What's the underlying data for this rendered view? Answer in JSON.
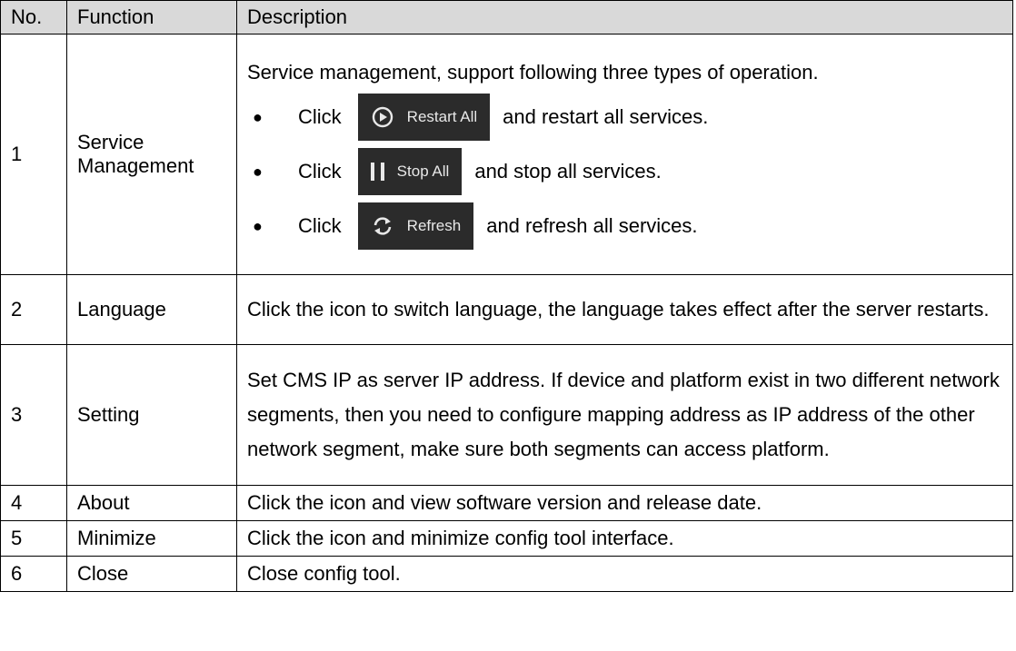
{
  "headers": {
    "no": "No.",
    "function": "Function",
    "description": "Description"
  },
  "rows": [
    {
      "no": "1",
      "function": "Service Management",
      "intro": "Service management, support following three types of operation.",
      "bullets": [
        {
          "prefix": "Click",
          "button": "Restart All",
          "icon": "restart-icon",
          "suffix": "and restart all services."
        },
        {
          "prefix": "Click",
          "button": "Stop All",
          "icon": "pause-icon",
          "suffix": "and stop all services."
        },
        {
          "prefix": "Click",
          "button": "Refresh",
          "icon": "refresh-icon",
          "suffix": "and refresh all services."
        }
      ]
    },
    {
      "no": "2",
      "function": "Language",
      "description": "Click the icon to switch language, the language takes effect after the server restarts."
    },
    {
      "no": "3",
      "function": "Setting",
      "description": "Set CMS IP as server IP address. If device and platform exist in two different network segments, then you need to configure mapping address as IP address of the other network segment, make sure both segments can access platform."
    },
    {
      "no": "4",
      "function": "About",
      "description": "Click the icon and view software version and release date."
    },
    {
      "no": "5",
      "function": "Minimize",
      "description": "Click the icon and minimize config tool interface."
    },
    {
      "no": "6",
      "function": "Close",
      "description": "Close config tool."
    }
  ],
  "colors": {
    "header_bg": "#d9d9d9",
    "button_bg": "#2b2b2b",
    "button_text": "#e8e8e8"
  }
}
